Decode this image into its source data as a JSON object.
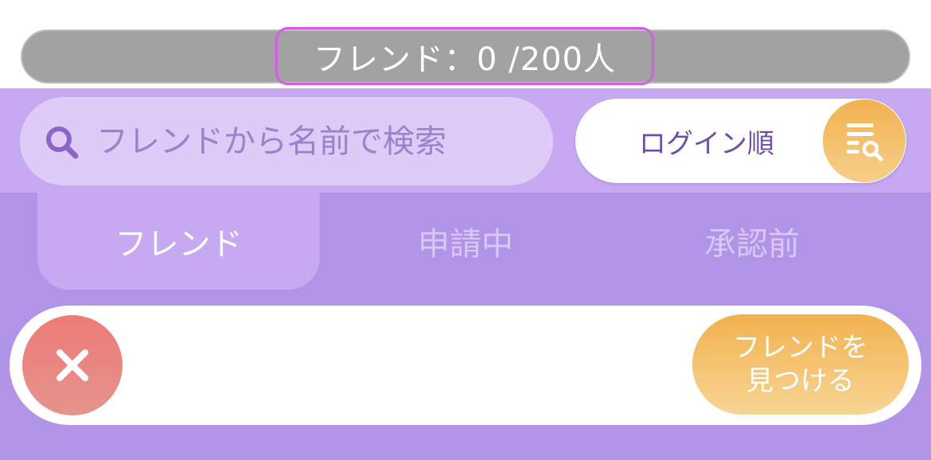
{
  "friend_count": {
    "label": "フレンド：0 /200人"
  },
  "search": {
    "placeholder": "フレンドから名前で検索",
    "value": "",
    "icon": "search-icon"
  },
  "sort": {
    "label": "ログイン順",
    "icon": "sort-filter-icon"
  },
  "tabs": [
    {
      "label": "フレンド",
      "active": true
    },
    {
      "label": "申請中",
      "active": false
    },
    {
      "label": "承認前",
      "active": false
    }
  ],
  "card": {
    "close_icon": "close-icon",
    "find_button": {
      "line1": "フレンドを",
      "line2": "見つける"
    }
  },
  "colors": {
    "count_bar": "#a2a2a2",
    "highlight_border": "#d35fe4",
    "band_light_purple": "#c6a9f1",
    "main_purple": "#b194e8",
    "search_field": "#decbf8",
    "accent_orange": "#f2b24f",
    "close_red": "#ee7b78",
    "text_purple": "#6e4fa6"
  }
}
